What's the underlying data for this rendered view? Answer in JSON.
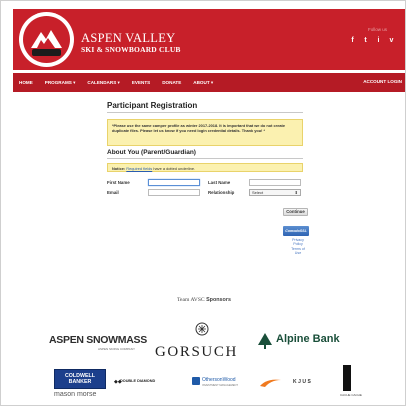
{
  "header": {
    "brand_line1": "ASPEN VALLEY",
    "brand_line2": "SKI & SNOWBOARD CLUB",
    "social_label": "Follow us",
    "social": [
      "f",
      "t",
      "i",
      "v"
    ],
    "colors": {
      "primary": "#c8202a",
      "nav": "#b51b25"
    }
  },
  "nav": {
    "items": [
      "HOME",
      "PROGRAMS ▾",
      "CALENDARS ▾",
      "EVENTS",
      "DONATE",
      "ABOUT ▾"
    ],
    "login": "ACCOUNT LOGIN"
  },
  "form": {
    "title": "Participant Registration",
    "notice": "*Please use the same camper profile as winter 2017-2018. It is important that we do not create duplicate files. Please let us know if you need login credential details. Thank you! *",
    "section_title": "About You (Parent/Guardian)",
    "required_notice_bold": "Notice:",
    "required_notice_link": "Required fields",
    "required_notice_rest": "have a dotted underline.",
    "labels": {
      "first_name": "First Name",
      "last_name": "Last Name",
      "email": "Email",
      "relationship": "Relationship"
    },
    "values": {
      "first_name": "",
      "last_name": "",
      "email": ""
    },
    "relationship_selected": "Select",
    "continue_label": "Continue",
    "comodo_label": "ComodoSSL",
    "policy_links": [
      "Privacy",
      "Policy",
      "Terms of",
      "Use"
    ]
  },
  "sponsors": {
    "title_prefix": "Team AVSC",
    "title_bold": "Sponsors",
    "aspen": "ASPEN SNOWMASS",
    "aspen_sub": "ASPEN SKIING COMPANY",
    "gorsuch": "GORSUCH",
    "alpine": "Alpine Bank",
    "coldwell": [
      "COLDWELL",
      "BANKER"
    ],
    "mason": "mason morse",
    "double_diamond": "DOUBLE DIAMOND",
    "otherson": "OthersonWood",
    "otherson_sub": "INVESTMENT MANAGEMENT",
    "kjus": "KJUS",
    "tower_sub": "CACHE CACHE"
  }
}
